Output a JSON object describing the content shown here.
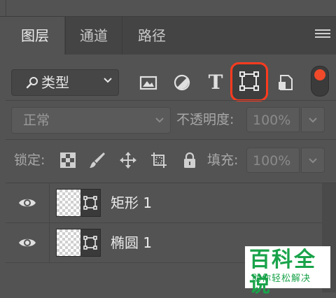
{
  "tabs": [
    {
      "label": "图层",
      "active": true
    },
    {
      "label": "通道",
      "active": false
    },
    {
      "label": "路径",
      "active": false
    }
  ],
  "filter": {
    "kind_label": "类型",
    "icons": [
      "image-filter-icon",
      "adjustment-filter-icon",
      "type-filter-icon",
      "shape-filter-icon",
      "smart-object-filter-icon"
    ],
    "type_glyph": "T",
    "highlight_color": "#ff3b1f",
    "toggle_color": "#f04a2a"
  },
  "blend": {
    "mode": "正常",
    "opacity_label": "不透明度:",
    "opacity_value": "100%"
  },
  "lock": {
    "label": "锁定:",
    "icons": [
      "lock-transparent-pixels-icon",
      "lock-image-pixels-icon",
      "lock-position-icon",
      "artboard-lock-icon",
      "lock-all-icon"
    ],
    "fill_label": "填充:",
    "fill_value": "100%"
  },
  "layers": [
    {
      "name": "矩形 1",
      "visible": true
    },
    {
      "name": "椭圆 1",
      "visible": true
    }
  ],
  "watermark": {
    "title": "百科全说",
    "subtitle": "助你轻松解决",
    "color": "#19a34a"
  }
}
